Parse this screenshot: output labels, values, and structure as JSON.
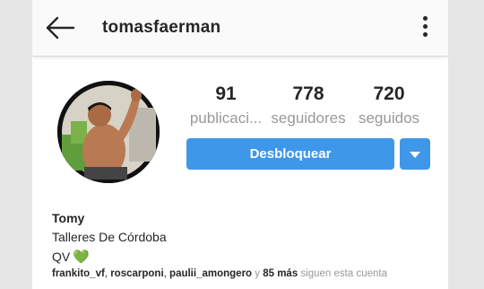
{
  "header": {
    "username": "tomasfaerman",
    "back_icon": "arrow-left-icon",
    "menu_icon": "more-vertical-icon"
  },
  "profile": {
    "avatar_alt": "profile photo",
    "stats": {
      "posts": {
        "value": "91",
        "label": "publicaci..."
      },
      "followers": {
        "value": "778",
        "label": "seguidores"
      },
      "following": {
        "value": "720",
        "label": "seguidos"
      }
    },
    "unblock_label": "Desbloquear",
    "dropdown_icon": "caret-down-icon"
  },
  "bio": {
    "name": "Tomy",
    "line1": "Talleres De Córdoba",
    "line2": "QV",
    "heart": "💚"
  },
  "followed_by": {
    "user1": "frankito_vf",
    "sep1": ",",
    "user2": "roscarponi",
    "sep2": ",",
    "user3": "paulii_amongero",
    "and": " y ",
    "more": "85 más",
    "suffix": " siguen esta cuenta"
  },
  "colors": {
    "accent": "#3f97ea",
    "text": "#262626",
    "muted": "#999999",
    "heart": "#6ec62f"
  }
}
